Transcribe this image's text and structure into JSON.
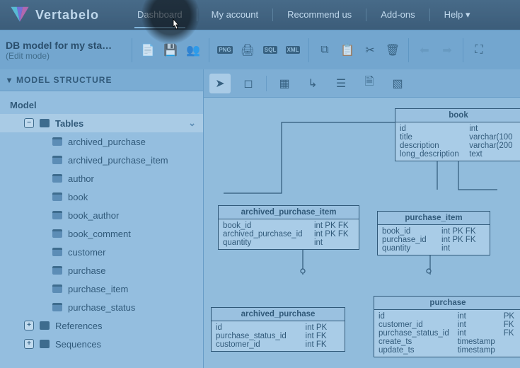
{
  "brand": "Vertabelo",
  "nav": {
    "dashboard": "Dashboard",
    "myaccount": "My account",
    "recommend": "Recommend us",
    "addons": "Add-ons",
    "help": "Help ▾"
  },
  "model": {
    "title": "DB model for my sta…",
    "mode": "(Edit mode)"
  },
  "sidebar": {
    "title": "MODEL STRUCTURE",
    "root": "Model",
    "tables_label": "Tables",
    "items": [
      "archived_purchase",
      "archived_purchase_item",
      "author",
      "book",
      "book_author",
      "book_comment",
      "customer",
      "purchase",
      "purchase_item",
      "purchase_status"
    ],
    "references": "References",
    "sequences": "Sequences"
  },
  "entities": {
    "book": {
      "name": "book",
      "rows": [
        [
          "id",
          "int",
          ""
        ],
        [
          "title",
          "varchar(100",
          ""
        ],
        [
          "description",
          "varchar(200",
          ""
        ],
        [
          "long_description",
          "text",
          ""
        ]
      ]
    },
    "api": {
      "name": "archived_purchase_item",
      "rows": [
        [
          "book_id",
          "int PK FK",
          ""
        ],
        [
          "archived_purchase_id",
          "int PK FK",
          ""
        ],
        [
          "quantity",
          "int",
          ""
        ]
      ]
    },
    "pi": {
      "name": "purchase_item",
      "rows": [
        [
          "book_id",
          "int PK FK",
          ""
        ],
        [
          "purchase_id",
          "int PK FK",
          ""
        ],
        [
          "quantity",
          "int",
          ""
        ]
      ]
    },
    "ap": {
      "name": "archived_purchase",
      "rows": [
        [
          "id",
          "int PK",
          ""
        ],
        [
          "purchase_status_id",
          "int FK",
          ""
        ],
        [
          "customer_id",
          "int FK",
          ""
        ]
      ]
    },
    "purchase": {
      "name": "purchase",
      "rows": [
        [
          "id",
          "int",
          "PK"
        ],
        [
          "customer_id",
          "int",
          "FK"
        ],
        [
          "purchase_status_id",
          "int",
          "FK"
        ],
        [
          "create_ts",
          "timestamp",
          ""
        ],
        [
          "update_ts",
          "timestamp",
          ""
        ]
      ]
    }
  }
}
